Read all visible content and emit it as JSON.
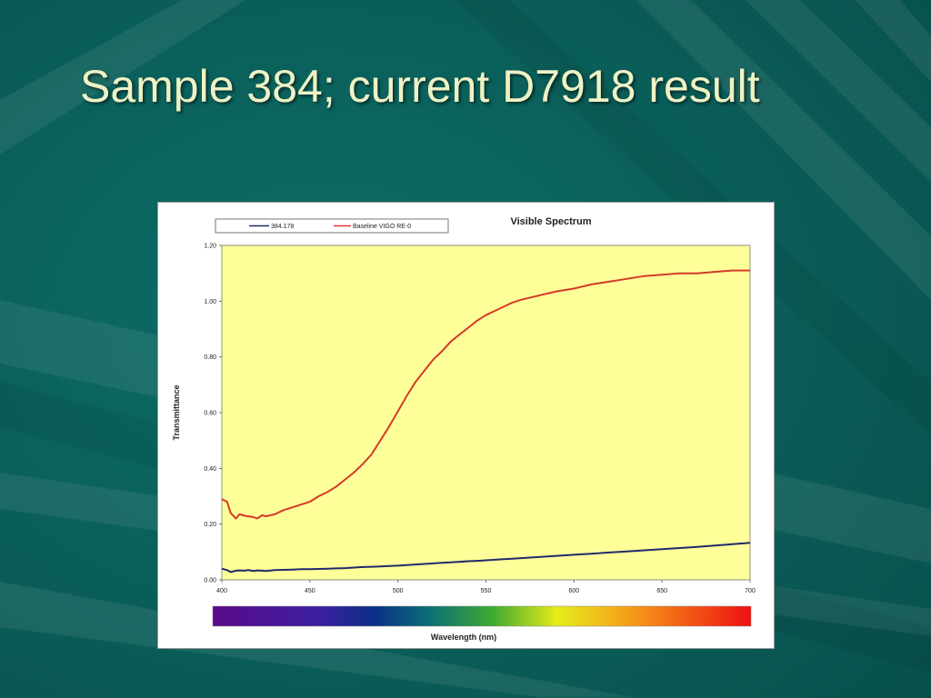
{
  "slide": {
    "title": "Sample 384; current D7918 result",
    "bg_color": "#0b5f5b",
    "title_color": "#eef2c4"
  },
  "chart_data": {
    "type": "line",
    "title": "Visible Spectrum",
    "xlabel": "Wavelength (nm)",
    "ylabel": "Transmittance",
    "xlim": [
      400,
      700
    ],
    "ylim": [
      0,
      1.2
    ],
    "x_ticks": [
      "400",
      "450",
      "500",
      "550",
      "600",
      "650",
      "700"
    ],
    "y_ticks": [
      "0.00",
      "0.20",
      "0.40",
      "0.60",
      "0.80",
      "1.00",
      "1.20"
    ],
    "grid": false,
    "plot_bg": "#ffff99",
    "spectrum_bar": true,
    "legend_position": "top-left",
    "x": [
      400,
      403,
      405,
      408,
      410,
      413,
      415,
      418,
      420,
      423,
      425,
      430,
      435,
      440,
      445,
      450,
      455,
      460,
      465,
      470,
      475,
      480,
      485,
      490,
      495,
      500,
      505,
      510,
      515,
      520,
      525,
      530,
      535,
      540,
      545,
      550,
      555,
      560,
      565,
      570,
      580,
      590,
      600,
      610,
      620,
      630,
      640,
      650,
      660,
      670,
      680,
      690,
      700
    ],
    "series": [
      {
        "name": "384.178",
        "color": "#1f2a6b",
        "values": [
          0.04,
          0.035,
          0.028,
          0.033,
          0.034,
          0.033,
          0.035,
          0.032,
          0.034,
          0.033,
          0.032,
          0.035,
          0.036,
          0.037,
          0.038,
          0.038,
          0.039,
          0.04,
          0.041,
          0.042,
          0.044,
          0.046,
          0.047,
          0.048,
          0.05,
          0.051,
          0.053,
          0.055,
          0.057,
          0.059,
          0.061,
          0.063,
          0.065,
          0.067,
          0.068,
          0.07,
          0.072,
          0.074,
          0.076,
          0.078,
          0.082,
          0.086,
          0.09,
          0.094,
          0.098,
          0.102,
          0.106,
          0.11,
          0.114,
          0.118,
          0.123,
          0.128,
          0.133
        ]
      },
      {
        "name": "Baseline VIGO RE-0",
        "color": "#d43a2a",
        "values": [
          0.29,
          0.28,
          0.24,
          0.22,
          0.235,
          0.23,
          0.228,
          0.225,
          0.22,
          0.232,
          0.228,
          0.235,
          0.25,
          0.26,
          0.27,
          0.28,
          0.3,
          0.315,
          0.335,
          0.36,
          0.385,
          0.415,
          0.45,
          0.5,
          0.55,
          0.605,
          0.66,
          0.71,
          0.75,
          0.79,
          0.82,
          0.855,
          0.88,
          0.905,
          0.93,
          0.95,
          0.965,
          0.98,
          0.995,
          1.005,
          1.02,
          1.035,
          1.045,
          1.06,
          1.07,
          1.08,
          1.09,
          1.095,
          1.1,
          1.1,
          1.105,
          1.11,
          1.11
        ]
      }
    ]
  }
}
